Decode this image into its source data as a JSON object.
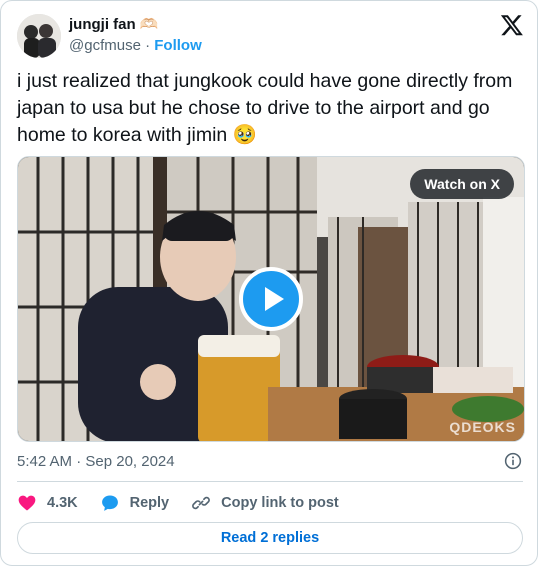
{
  "tweet": {
    "author_name": "jungji fan 🫶🏻",
    "handle": "@gcfmuse",
    "separator": "·",
    "follow_label": "Follow",
    "text": "i just realized that jungkook could have gone directly from japan to usa but he chose to drive to the airport and go home to korea with jimin 🥹",
    "timestamp": "5:42 AM · Sep 20, 2024"
  },
  "media": {
    "watch_label": "Watch on X",
    "watermark": "QDEOKS"
  },
  "actions": {
    "likes_count": "4.3K",
    "reply_label": "Reply",
    "copy_label": "Copy link to post",
    "read_replies_label": "Read 2 replies"
  },
  "colors": {
    "accent": "#1d9bf0",
    "like": "#f91880",
    "muted": "#536471",
    "link": "#006fd6"
  }
}
